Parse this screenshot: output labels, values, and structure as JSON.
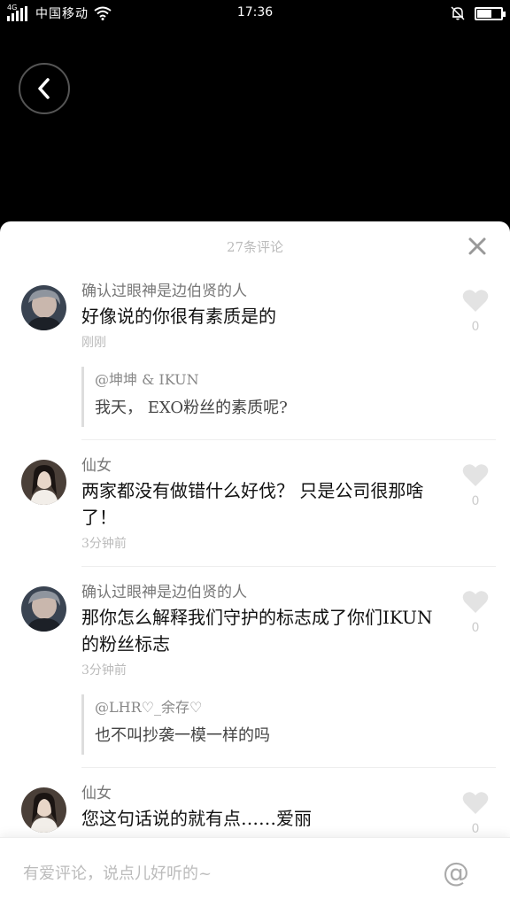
{
  "status_bar": {
    "network": "4G",
    "carrier": "中国移动",
    "time": "17:36",
    "battery_level": 0.6
  },
  "header": {
    "back_icon": "chevron-left-icon"
  },
  "sheet": {
    "title": "27条评论",
    "close_icon": "close-icon"
  },
  "comments": [
    {
      "avatar": "male-avatar",
      "username": "确认过眼神是边伯贤的人",
      "text": "好像说的你很有素质是的",
      "time": "刚刚",
      "likes": "0",
      "reply": {
        "user": "@坤坤 & IKUN",
        "text": "我天， EXO粉丝的素质呢?"
      }
    },
    {
      "avatar": "female-avatar",
      "username": "仙女",
      "text": "两家都没有做错什么好伐？ 只是公司很那啥了！",
      "time": "3分钟前",
      "likes": "0"
    },
    {
      "avatar": "male-avatar",
      "username": "确认过眼神是边伯贤的人",
      "text": "那你怎么解释我们守护的标志成了你们IKUN的粉丝标志",
      "time": "3分钟前",
      "likes": "0",
      "reply": {
        "user": "@LHR♡_余存♡",
        "text": "也不叫抄袭一模一样的吗"
      }
    },
    {
      "avatar": "female-avatar",
      "username": "仙女",
      "text": "您这句话说的就有点……爱丽",
      "likes": "0"
    }
  ],
  "input_bar": {
    "placeholder": "有爱评论，说点儿好听的~",
    "value": "",
    "at_symbol": "@"
  },
  "colors": {
    "background": "#000000",
    "sheet": "#ffffff",
    "muted_text": "#bbbbbb"
  }
}
